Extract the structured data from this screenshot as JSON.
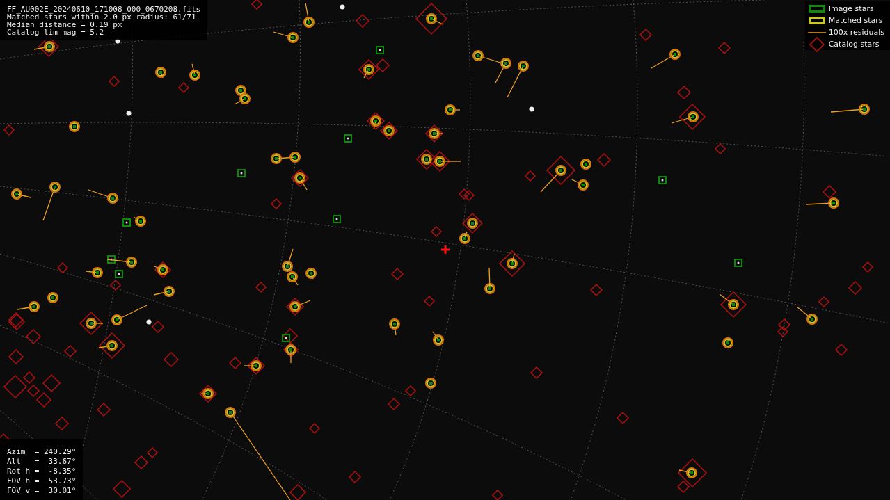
{
  "info_panel": {
    "lines": [
      "FF_AU002E_20240610_171008_000_0670208.fits",
      "Matched stars within 2.0 px radius: 61/71",
      "Median distance = 0.19 px",
      "Catalog lim mag = 5.2"
    ]
  },
  "legend": [
    {
      "kind": "image",
      "label": "Image stars"
    },
    {
      "kind": "matched",
      "label": "Matched stars"
    },
    {
      "kind": "residual",
      "label": "100x residuals"
    },
    {
      "kind": "catalog",
      "label": "Catalog stars"
    }
  ],
  "pointing": {
    "lines": [
      "Azim  = 240.29°",
      "Alt   =  33.67°",
      "Rot h =  -8.35°",
      "FOV h =  53.73°",
      "FOV v =  30.01°"
    ]
  }
}
